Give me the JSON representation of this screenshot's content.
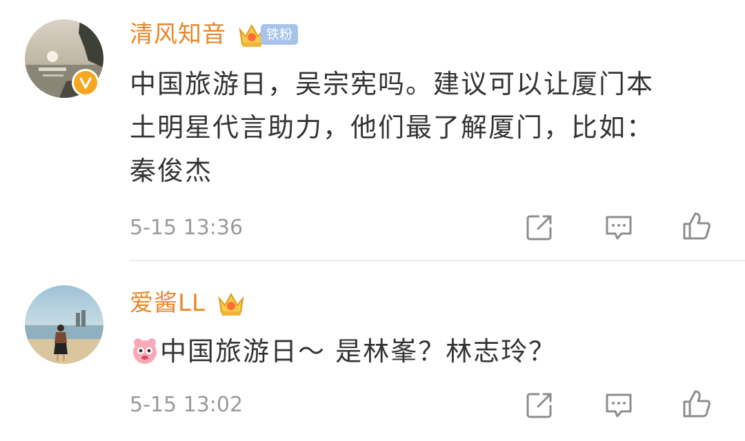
{
  "comments": [
    {
      "username": "清风知音",
      "fan_badge": "铁粉",
      "text_lines": [
        "中国旅游日，吴宗宪吗。建议可以让厦门本",
        "土明星代言助力，他们最了解厦门，比如：",
        "秦俊杰"
      ],
      "timestamp": "5-15 13:36",
      "avatar_icon": "sunset-sea-avatar",
      "verified_icon": "verified-v-icon",
      "crown_icon": "vip-crown-icon",
      "actions": [
        "share-icon",
        "comment-icon",
        "like-icon"
      ]
    },
    {
      "username": "爱酱LL",
      "text_prefix": "中国旅游日～ 是林峯？林志玲？",
      "timestamp": "5-15 13:02",
      "avatar_icon": "beach-girl-avatar",
      "crown_icon": "vip-crown-icon",
      "emoji_icon": "pink-face-emoji-icon",
      "actions": [
        "share-icon",
        "comment-icon",
        "like-icon"
      ]
    }
  ],
  "colors": {
    "username": "#e8862a",
    "body_text": "#333333",
    "timestamp": "#9a9a9a",
    "fan_badge_bg": "#a7c3ea",
    "verified": "#f5a623",
    "divider": "#ececec"
  }
}
